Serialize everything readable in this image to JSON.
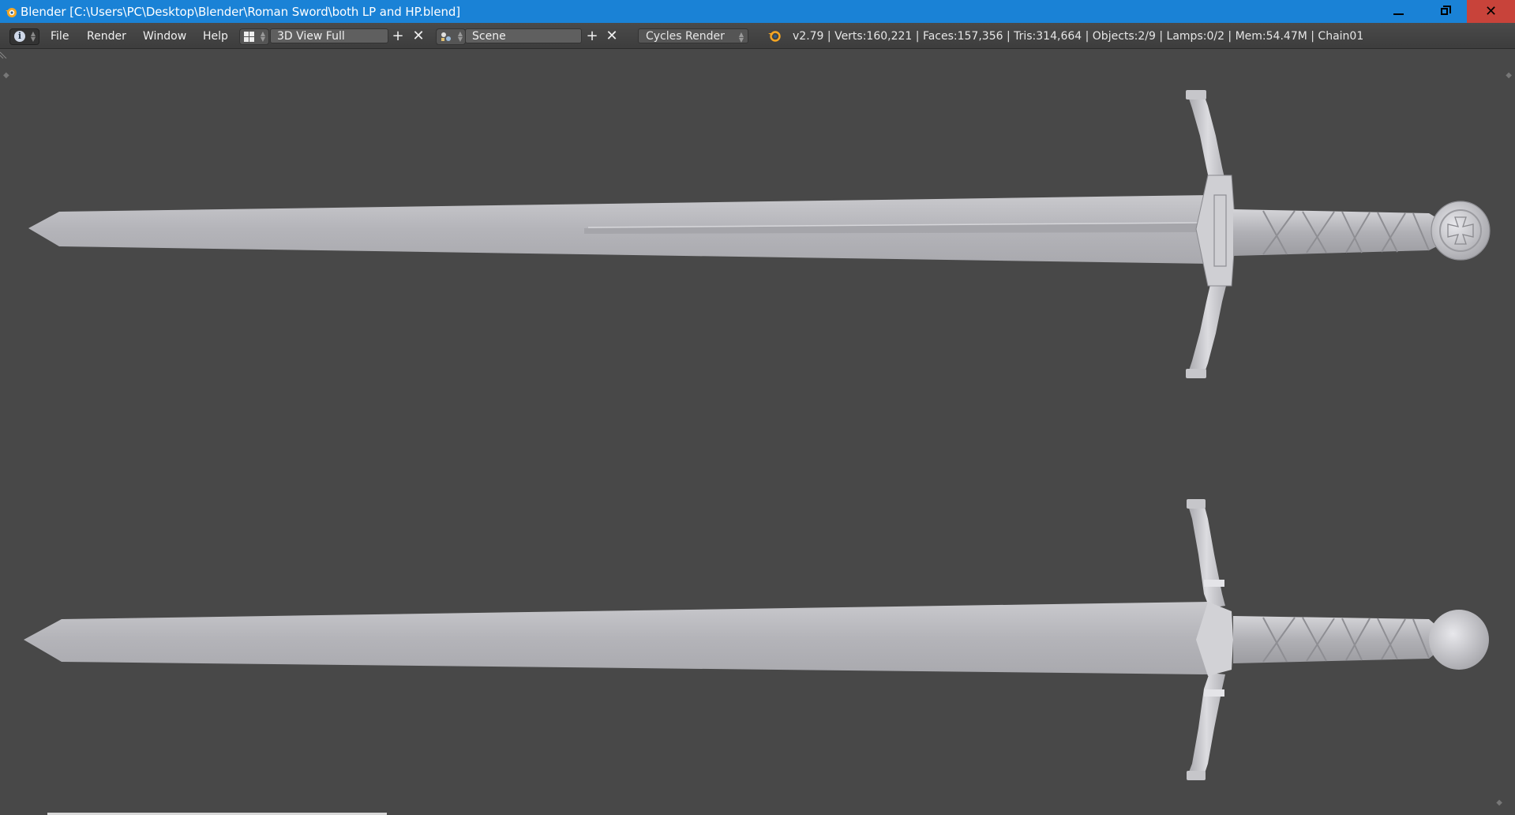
{
  "window": {
    "title": "Blender [C:\\Users\\PC\\Desktop\\Blender\\Roman Sword\\both LP and HP.blend]",
    "controls": {
      "minimize": "minimize",
      "maximize": "restore",
      "close": "✕"
    }
  },
  "header": {
    "menus": [
      "File",
      "Render",
      "Window",
      "Help"
    ],
    "screen_layout": "3D View Full",
    "scene": "Scene",
    "render_engine": "Cycles Render",
    "stats": "v2.79 | Verts:160,221 | Faces:157,356 | Tris:314,664 | Objects:2/9 | Lamps:0/2 | Mem:54.47M | Chain01"
  },
  "viewport": {
    "objects": [
      "high-poly-sword",
      "low-poly-sword"
    ],
    "background_color": "#484848",
    "model_color": "#b9b9bd"
  },
  "colors": {
    "titlebar": "#1a82d6",
    "close_button": "#c8433a",
    "header_bg": "#434343"
  }
}
